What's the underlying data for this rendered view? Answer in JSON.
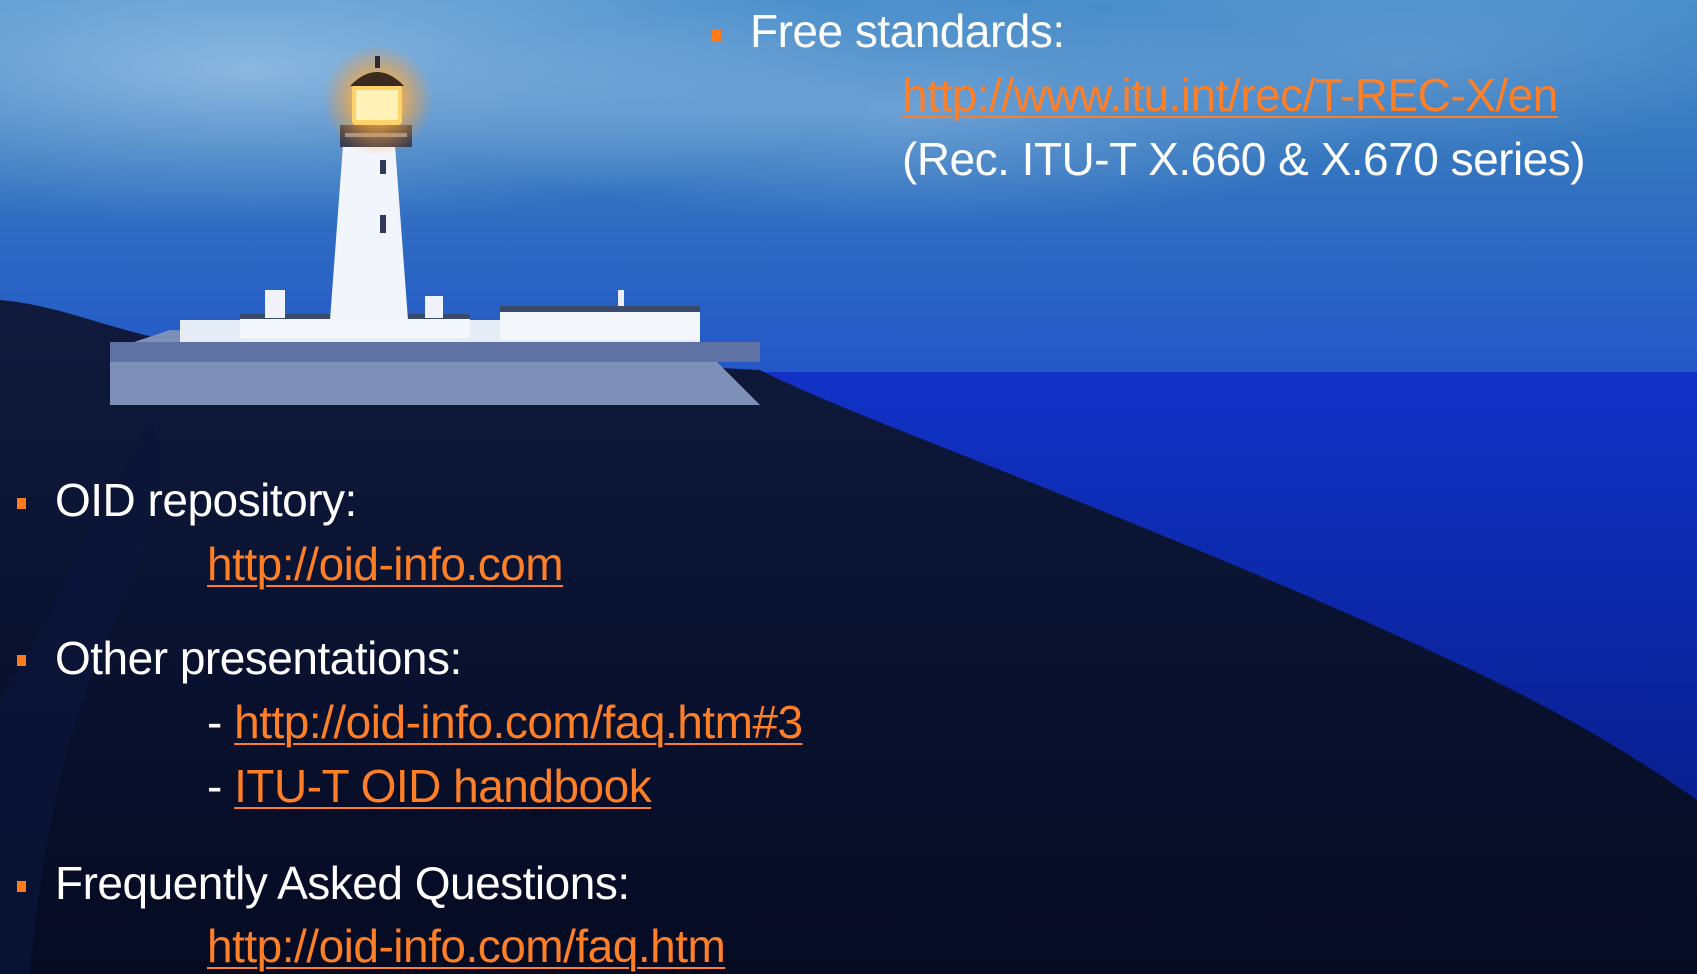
{
  "slide": {
    "free_standards": {
      "label": "Free standards:",
      "link": "http://www.itu.int/rec/T-REC-X/en",
      "note": "(Rec. ITU-T X.660 & X.670 series)"
    },
    "oid_repository": {
      "label": "OID repository:",
      "link": "http://oid-info.com"
    },
    "other_presentations": {
      "label": "Other presentations:",
      "dash1": "- ",
      "link1": "http://oid-info.com/faq.htm#3",
      "dash2": "- ",
      "link2": "ITU-T OID handbook"
    },
    "faq": {
      "label": "Frequently Asked Questions:",
      "link": "http://oid-info.com/faq.htm"
    }
  },
  "colors": {
    "bullet": "#ff7a1a",
    "link": "#ff7f27",
    "text": "#ffffff"
  },
  "background": {
    "icon": "lighthouse-landscape-photo"
  }
}
